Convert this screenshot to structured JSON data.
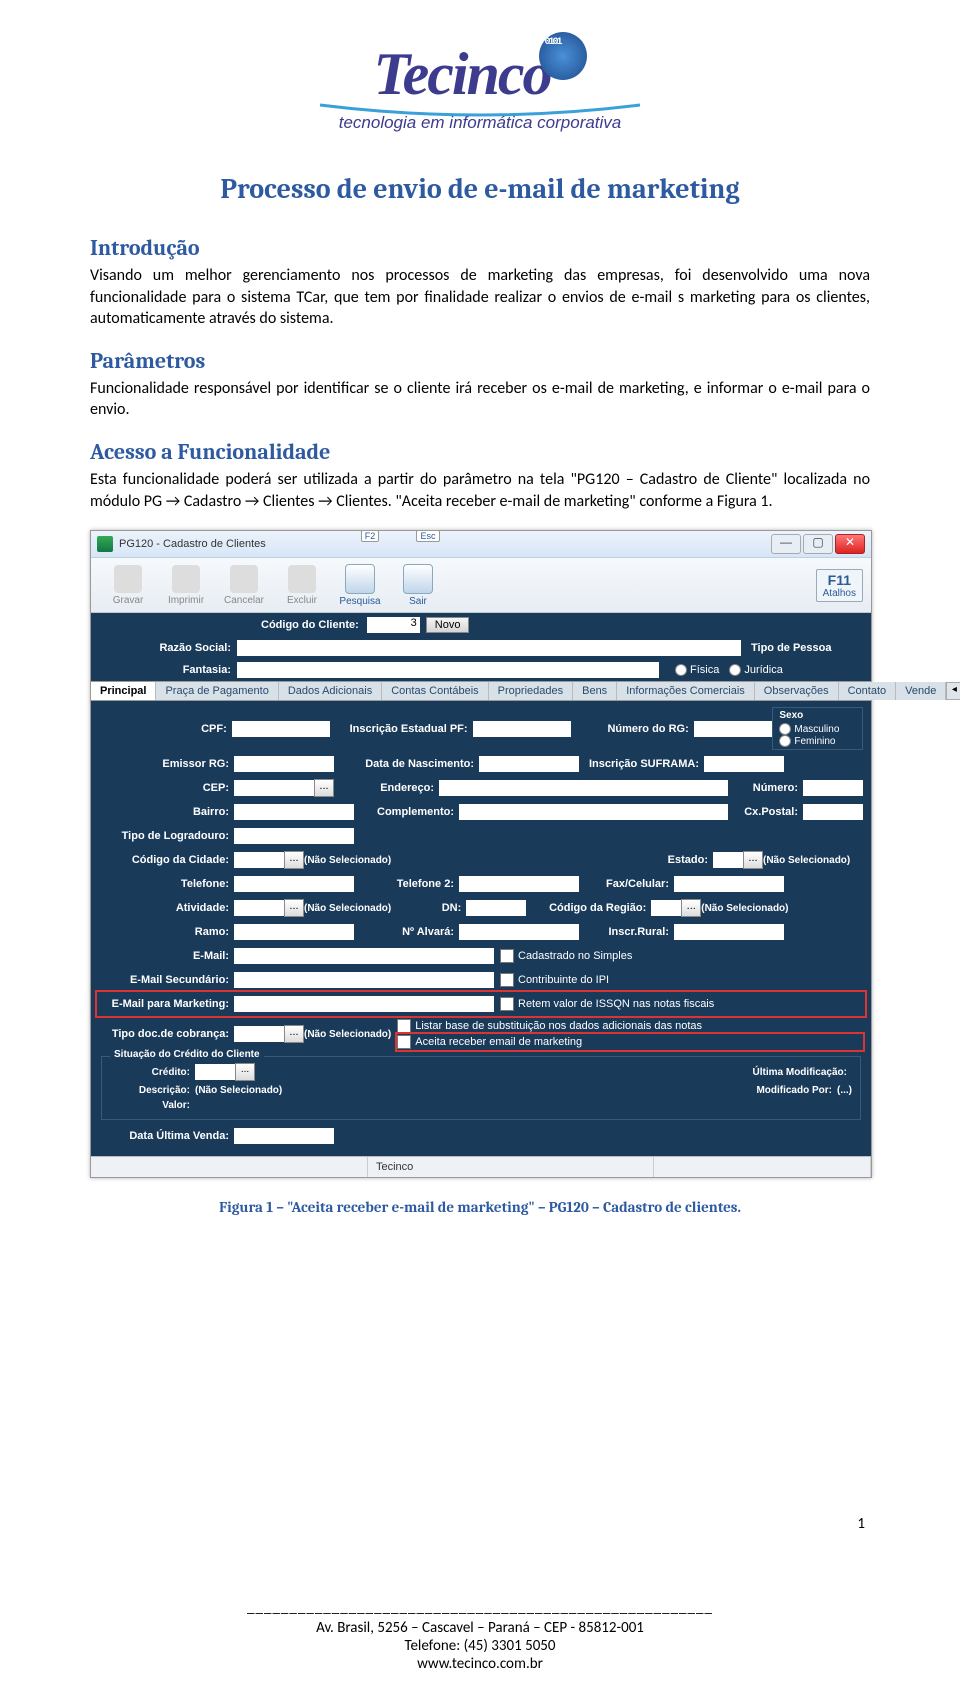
{
  "logo": {
    "name": "Tecinco",
    "tagline": "tecnologia em informática corporativa"
  },
  "title": "Processo de envio de e-mail de marketing",
  "sections": {
    "intro_h": "Introdução",
    "intro_p": "Visando um melhor gerenciamento nos processos de marketing das empresas, foi desenvolvido uma nova funcionalidade para o sistema TCar, que tem por finalidade realizar o envios de e-mail s marketing para os clientes, automaticamente através do sistema.",
    "param_h": "Parâmetros",
    "param_p": "Funcionalidade responsável por identificar se o cliente irá receber os e-mail de marketing, e informar o e-mail para o envio.",
    "acesso_h": "Acesso a Funcionalidade",
    "acesso_p": "Esta funcionalidade poderá ser utilizada a partir do parâmetro na tela \"PG120 – Cadastro de Cliente\" localizada no módulo PG → Cadastro → Clientes → Clientes. \"Aceita receber e-mail de marketing\" conforme a Figura 1."
  },
  "window": {
    "title": "PG120 - Cadastro de Clientes",
    "toolbar": {
      "gravar": "Gravar",
      "imprimir": "Imprimir",
      "cancelar": "Cancelar",
      "excluir": "Excluir",
      "pesquisa": "Pesquisa",
      "pesquisa_key": "F2",
      "sair": "Sair",
      "sair_key": "Esc",
      "atalhos_key": "F11",
      "atalhos": "Atalhos"
    },
    "codigo_lbl": "Código do Cliente:",
    "codigo_val": "3",
    "novo_btn": "Novo",
    "header": {
      "razao": "Razão Social:",
      "fantasia": "Fantasia:",
      "tipo_pessoa": "Tipo de Pessoa",
      "fisica": "Física",
      "juridica": "Jurídica"
    },
    "tabs": [
      "Principal",
      "Praça de Pagamento",
      "Dados Adicionais",
      "Contas Contábeis",
      "Propriedades",
      "Bens",
      "Informações Comerciais",
      "Observações",
      "Contato",
      "Vende"
    ],
    "labels": {
      "cpf": "CPF:",
      "insc_pf": "Inscrição Estadual PF:",
      "num_rg": "Número do RG:",
      "emissor_rg": "Emissor RG:",
      "data_nasc": "Data de Nascimento:",
      "insc_suframa": "Inscrição SUFRAMA:",
      "cep": "CEP:",
      "endereco": "Endereço:",
      "numero": "Número:",
      "bairro": "Bairro:",
      "complemento": "Complemento:",
      "cxpostal": "Cx.Postal:",
      "tipo_log": "Tipo de Logradouro:",
      "cod_cidade": "Código da Cidade:",
      "nao_sel": "(Não Selecionado)",
      "estado": "Estado:",
      "telefone": "Telefone:",
      "telefone2": "Telefone 2:",
      "fax": "Fax/Celular:",
      "atividade": "Atividade:",
      "dn": "DN:",
      "cod_regiao": "Código da Região:",
      "ramo": "Ramo:",
      "n_alvara": "Nº Alvará:",
      "inscr_rural": "Inscr.Rural:",
      "email": "E-Mail:",
      "email_sec": "E-Mail Secundário:",
      "email_mkt": "E-Mail para Marketing:",
      "tipo_doc": "Tipo doc.de cobrança:",
      "sexo": "Sexo",
      "masc": "Masculino",
      "fem": "Feminino"
    },
    "checks": {
      "cad_simples": "Cadastrado no Simples",
      "contrib_ipi": "Contribuinte do IPI",
      "retem_issqn": "Retem valor de ISSQN nas notas fiscais",
      "listar_base": "Listar base de substituição nos dados adicionais das notas",
      "aceita_email": "Aceita receber email de marketing"
    },
    "group": {
      "title": "Situação do Crédito do Cliente",
      "credito": "Crédito:",
      "descricao_lbl": "Descrição:",
      "descricao_val": "(Não Selecionado)",
      "valor": "Valor:",
      "ult_mod": "Última Modificação:",
      "mod_por": "Modificado Por:",
      "mod_por_val": "(...)"
    },
    "ultima_venda": "Data Última Venda:",
    "status_company": "Tecinco"
  },
  "caption": "Figura 1 – \"Aceita receber e-mail de marketing\" – PG120 – Cadastro de clientes.",
  "page_number": "1",
  "footer": {
    "divider": "_______________________________________________________",
    "addr": "Av. Brasil, 5256 – Cascavel – Paraná – CEP - 85812-001",
    "tel": "Telefone: (45) 3301 5050",
    "site": "www.tecinco.com.br"
  }
}
